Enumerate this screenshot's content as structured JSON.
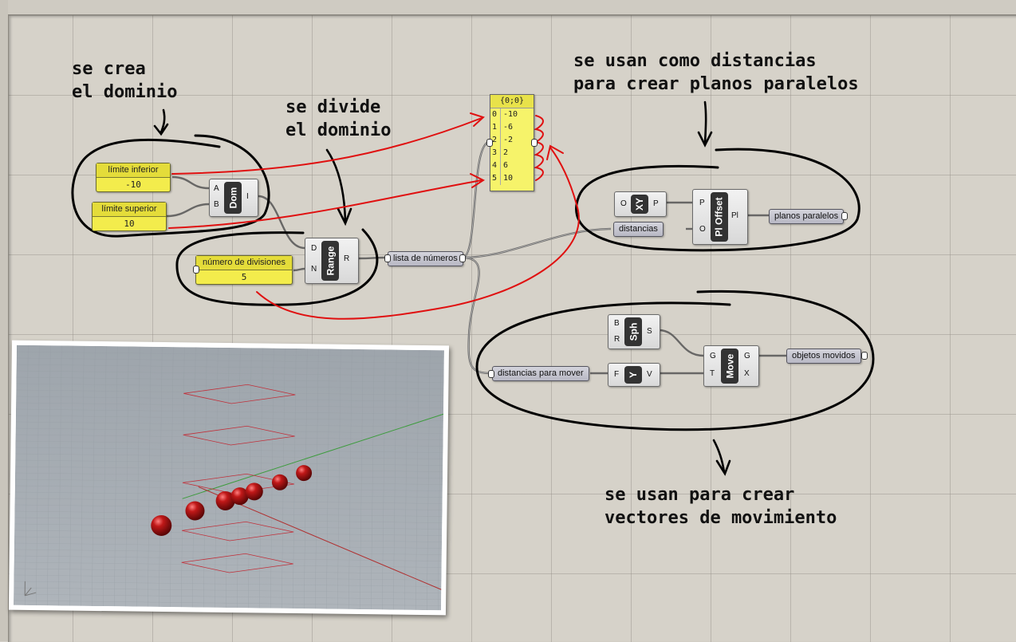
{
  "notes": {
    "domain": [
      "se crea",
      "el dominio"
    ],
    "divide": [
      "se divide",
      "el dominio"
    ],
    "planes": [
      "se usan como distancias",
      "para crear planos paralelos"
    ],
    "vectors": [
      "se usan para crear",
      "vectores de movimiento"
    ]
  },
  "sliders": {
    "lower": {
      "label": "límite inferior",
      "value": "-10"
    },
    "upper": {
      "label": "límite superior",
      "value": "10"
    },
    "divisions": {
      "label": "número de divisiones",
      "value": "5"
    }
  },
  "components": {
    "domain": {
      "core": "Dom",
      "inputs": [
        "A",
        "B"
      ],
      "outputs": [
        "I"
      ]
    },
    "range": {
      "core": "Range",
      "inputs": [
        "D",
        "N"
      ],
      "outputs": [
        "R"
      ]
    },
    "xy": {
      "core": "XY",
      "inputs": [
        "O"
      ],
      "outputs": [
        "P"
      ]
    },
    "offset": {
      "core": "Pl Offset",
      "inputs": [
        "P",
        "O"
      ],
      "outputs": [
        "Pl"
      ]
    },
    "sphere": {
      "core": "Sph",
      "inputs": [
        "B",
        "R"
      ],
      "outputs": [
        "S"
      ]
    },
    "yvec": {
      "core": "Y",
      "inputs": [
        "F"
      ],
      "outputs": [
        "V"
      ]
    },
    "move": {
      "core": "Move",
      "inputs": [
        "G",
        "T"
      ],
      "outputs": [
        "G",
        "X"
      ]
    }
  },
  "params": {
    "numbers": "lista de números",
    "distances": "distancias",
    "planes": "planos paralelos",
    "move_dist": "distancias para mover",
    "moved": "objetos movidos"
  },
  "panel": {
    "header": "{0;0}",
    "rows": [
      {
        "i": "0",
        "v": "-10"
      },
      {
        "i": "1",
        "v": "-6"
      },
      {
        "i": "2",
        "v": "-2"
      },
      {
        "i": "3",
        "v": "2"
      },
      {
        "i": "4",
        "v": "6"
      },
      {
        "i": "5",
        "v": "10"
      }
    ]
  },
  "colors": {
    "annotation_red": "#e01010",
    "slider_yellow": "#f3ec4c",
    "sphere_red": "#b01010",
    "grid_red": "#c0303a"
  }
}
